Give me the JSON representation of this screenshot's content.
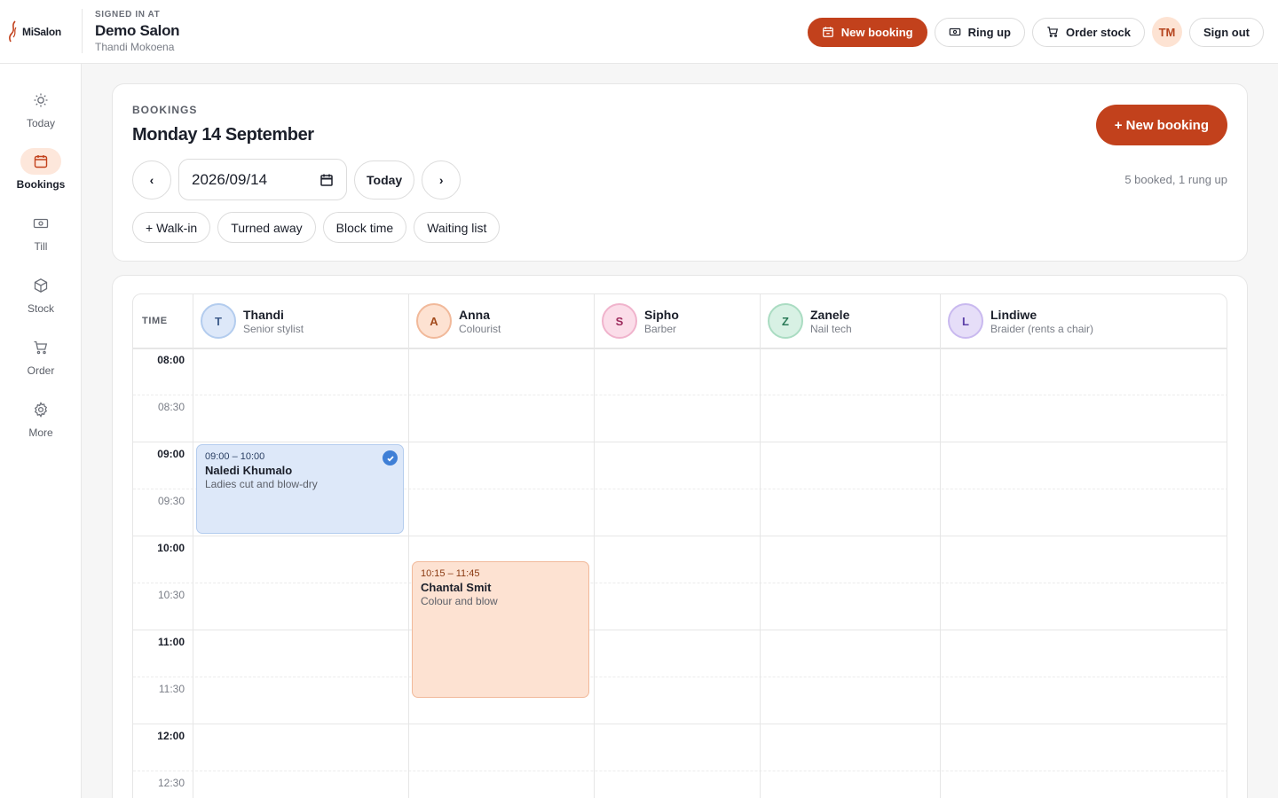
{
  "brand": {
    "logo_text": "MiSalon"
  },
  "session": {
    "signed_in_label": "SIGNED IN AT",
    "salon": "Demo Salon",
    "user": "Thandi Mokoena",
    "initials": "TM"
  },
  "top_actions": {
    "new_booking": "New booking",
    "ring_up": "Ring up",
    "order_stock": "Order stock",
    "sign_out": "Sign out"
  },
  "sidebar": {
    "items": [
      {
        "label": "Today",
        "icon": "sun-icon"
      },
      {
        "label": "Bookings",
        "icon": "calendar-icon",
        "active": true
      },
      {
        "label": "Till",
        "icon": "cash-icon"
      },
      {
        "label": "Stock",
        "icon": "box-icon"
      },
      {
        "label": "Order",
        "icon": "cart-icon"
      },
      {
        "label": "More",
        "icon": "gear-icon"
      }
    ]
  },
  "bookings": {
    "section_label": "BOOKINGS",
    "date_title": "Monday 14 September",
    "new_booking": "+ New booking",
    "prev": "‹",
    "next": "›",
    "date_value": "2026/09/14",
    "today": "Today",
    "summary": "5 booked, 1 rung up",
    "chips": [
      "+ Walk-in",
      "Turned away",
      "Block time",
      "Waiting list"
    ]
  },
  "calendar": {
    "time_header": "TIME",
    "staff": [
      {
        "initial": "T",
        "name": "Thandi",
        "role": "Senior stylist",
        "color": "#3d5b8a",
        "bg": "#dde8f9",
        "border": "#b3ccee"
      },
      {
        "initial": "A",
        "name": "Anna",
        "role": "Colourist",
        "color": "#a24a1c",
        "bg": "#fde2d2",
        "border": "#f1b99a"
      },
      {
        "initial": "S",
        "name": "Sipho",
        "role": "Barber",
        "color": "#9c2a5c",
        "bg": "#fbdde9",
        "border": "#f0b3cc"
      },
      {
        "initial": "Z",
        "name": "Zanele",
        "role": "Nail tech",
        "color": "#2b7a58",
        "bg": "#d8f1e4",
        "border": "#aadcc2"
      },
      {
        "initial": "L",
        "name": "Lindiwe",
        "role": "Braider (rents a chair)",
        "color": "#5b3fa8",
        "bg": "#e6def8",
        "border": "#c9b9ef"
      }
    ],
    "times": [
      "08:00",
      "08:30",
      "09:00",
      "09:30",
      "10:00",
      "10:30",
      "11:00",
      "11:30",
      "12:00",
      "12:30"
    ],
    "events": [
      {
        "time": "09:00 – 10:00",
        "client": "Naledi Khumalo",
        "service": "Ladies cut and blow-dry",
        "confirmed": true
      },
      {
        "time": "10:15 – 11:45",
        "client": "Chantal Smit",
        "service": "Colour and blow",
        "confirmed": false
      }
    ]
  },
  "colors": {
    "accent": "#c2411c",
    "accent_soft": "#fde7db"
  }
}
